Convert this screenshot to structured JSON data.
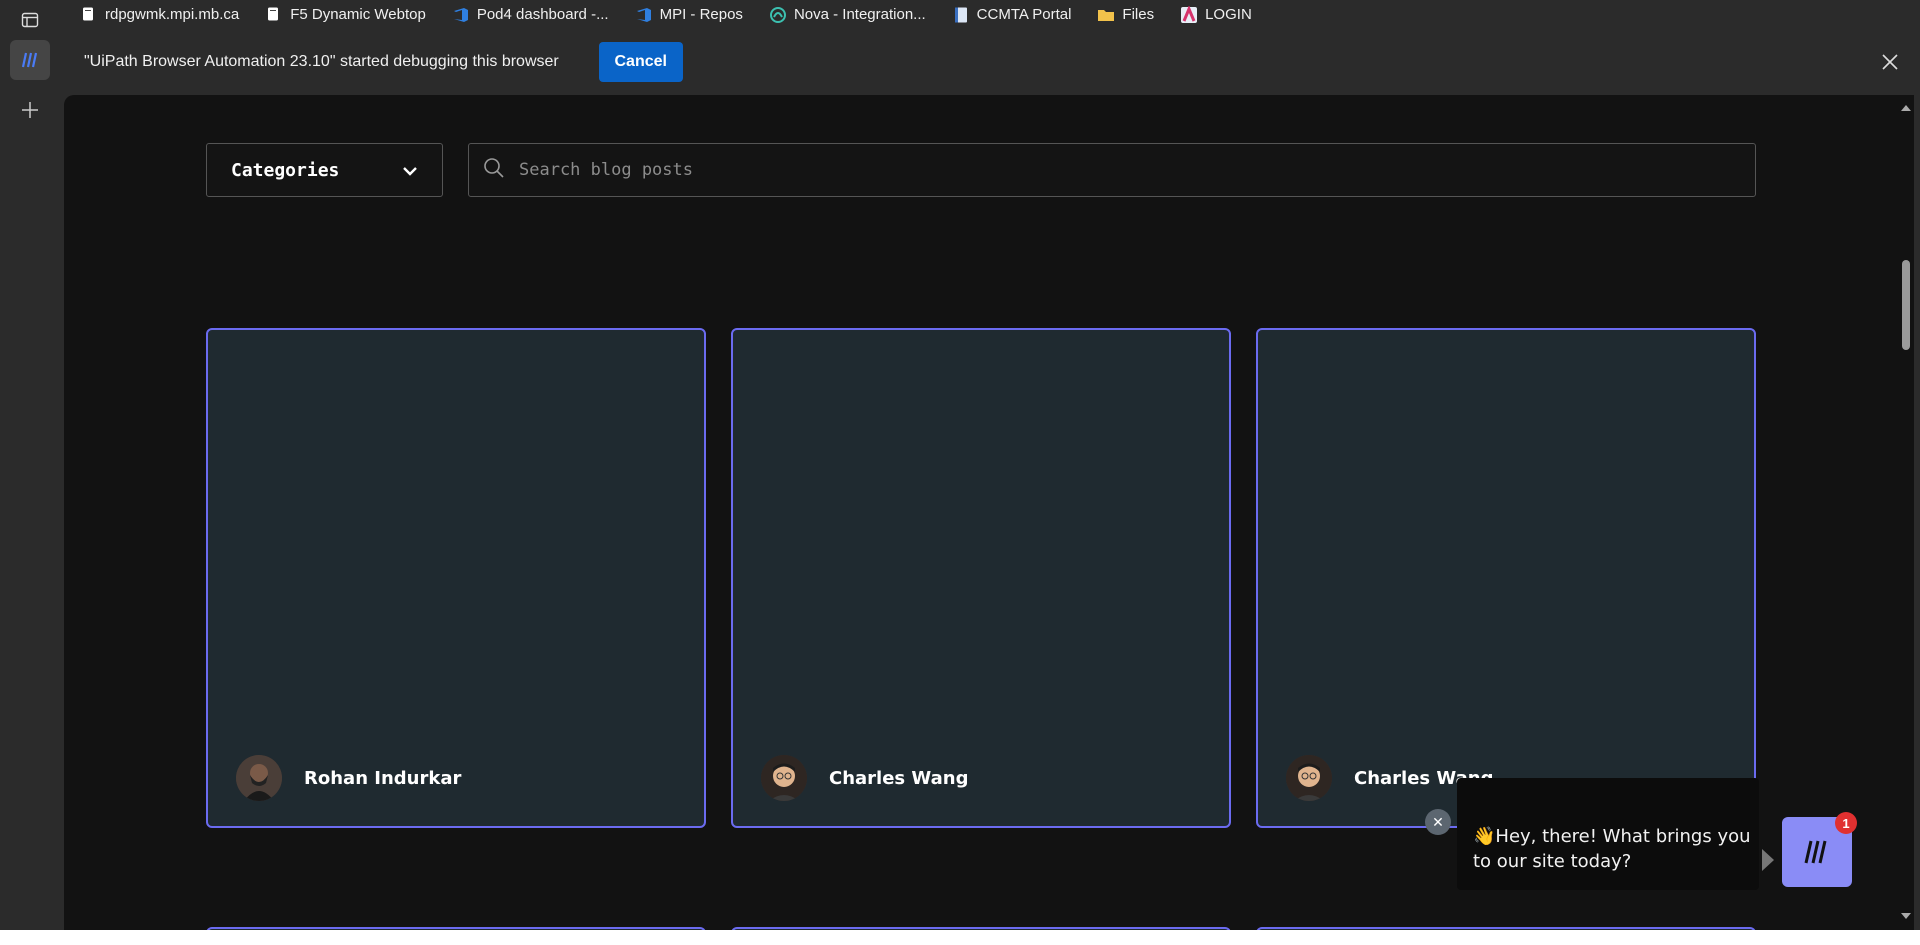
{
  "browser": {
    "bookmarks": [
      {
        "label": "rdpgwmk.mpi.mb.ca",
        "icon": "page-icon"
      },
      {
        "label": "F5 Dynamic Webtop",
        "icon": "page-icon"
      },
      {
        "label": "Pod4 dashboard -...",
        "icon": "azure-devops-icon"
      },
      {
        "label": "MPI - Repos",
        "icon": "azure-devops-icon"
      },
      {
        "label": "Nova - Integration...",
        "icon": "nova-icon"
      },
      {
        "label": "CCMTA Portal",
        "icon": "document-icon"
      },
      {
        "label": "Files",
        "icon": "folder-icon"
      },
      {
        "label": "LOGIN",
        "icon": "login-icon"
      }
    ],
    "infobar": {
      "message": "\"UiPath Browser Automation 23.10\" started debugging this browser",
      "cancel_label": "Cancel"
    }
  },
  "page": {
    "categories_label": "Categories",
    "search_placeholder": "Search blog posts",
    "posts": [
      {
        "author": "Rohan Indurkar"
      },
      {
        "author": "Charles Wang"
      },
      {
        "author": "Charles Wang"
      }
    ]
  },
  "chat": {
    "greeting": "👋Hey, there! What brings you to our site today?",
    "badge_count": "1"
  },
  "colors": {
    "card_border": "#6b6bf0",
    "card_bg": "#1f2a30",
    "accent_button": "#0a64c8",
    "launcher": "#8a8cf6"
  }
}
